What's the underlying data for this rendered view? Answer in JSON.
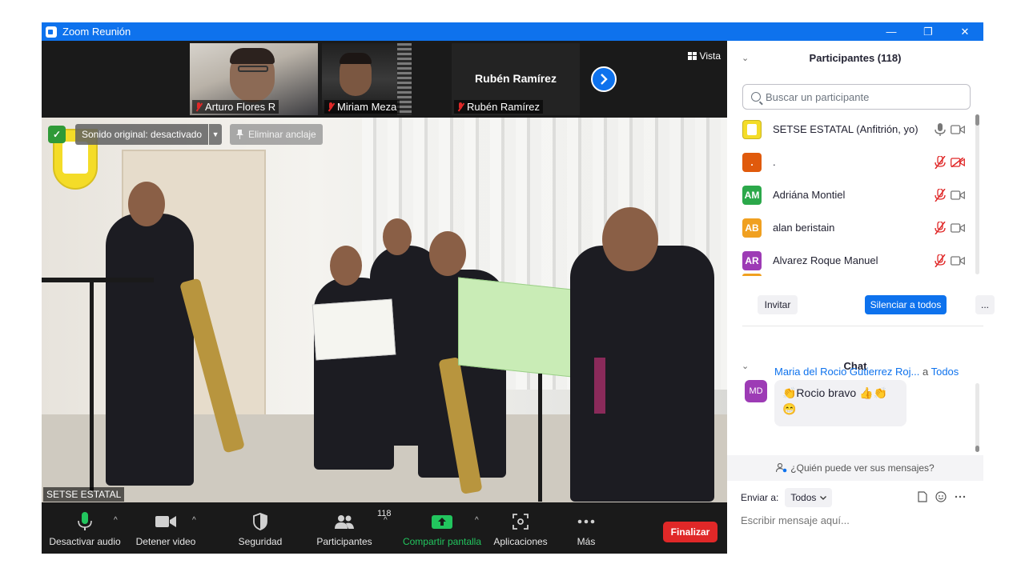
{
  "window": {
    "title": "Zoom Reunión",
    "controls": [
      "—",
      "❐",
      "✕"
    ]
  },
  "video": {
    "thumbnails": [
      {
        "name": "Arturo Flores R"
      },
      {
        "name": "Miriam Meza"
      },
      {
        "name": "Rubén Ramírez",
        "display_label": "Rubén Ramírez"
      }
    ],
    "view_label": "Vista",
    "sound_label": "Sonido original: desactivado",
    "unpin_label": "Eliminar anclaje",
    "speaker_name": "SETSE ESTATAL"
  },
  "toolbar": {
    "mute_label": "Desactivar audio",
    "video_label": "Detener video",
    "security_label": "Seguridad",
    "participants_label": "Participantes",
    "participants_count": "118",
    "share_label": "Compartir pantalla",
    "apps_label": "Aplicaciones",
    "more_label": "Más",
    "end_label": "Finalizar"
  },
  "participants_panel": {
    "title": "Participantes (118)",
    "search_placeholder": "Buscar un participante",
    "participants": [
      {
        "initials": "",
        "name": "SETSE ESTATAL (Anfitrión, yo)",
        "color": "#f4dc28",
        "muted": false,
        "video_off": false
      },
      {
        "initials": ".",
        "name": ".",
        "color": "#e05a0c",
        "muted": true,
        "video_off": true
      },
      {
        "initials": "AM",
        "name": "Adriána Montiel",
        "color": "#2ba84a",
        "muted": true,
        "video_off": false
      },
      {
        "initials": "AB",
        "name": "alan beristain",
        "color": "#f0a020",
        "muted": true,
        "video_off": false
      },
      {
        "initials": "AR",
        "name": "Alvarez Roque Manuel",
        "color": "#9d3bb5",
        "muted": true,
        "video_off": false
      }
    ],
    "invite_label": "Invitar",
    "mute_all_label": "Silenciar a todos",
    "more_label": "..."
  },
  "chat_panel": {
    "title": "Chat",
    "message": {
      "sender_initials": "MD",
      "sender": "Maria del Rocio Gutierrez Roj...",
      "to_prefix": "a",
      "to": "Todos",
      "text": "👏Rocio bravo 👍👏\n😁"
    },
    "who_sees_label": "¿Quién puede ver sus mensajes?",
    "send_to_label": "Enviar a:",
    "send_to_value": "Todos",
    "input_placeholder": "Escribir mensaje aquí..."
  },
  "colors": {
    "zoom_blue": "#0e72ed",
    "end_red": "#e02828",
    "share_green": "#22c55e",
    "dark_bg": "#1a1a1a"
  }
}
